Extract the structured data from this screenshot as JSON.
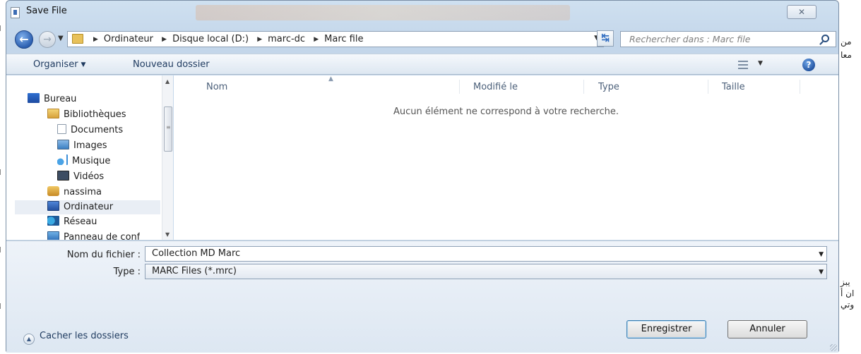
{
  "window": {
    "title": "Save File",
    "close_glyph": "✕"
  },
  "address": {
    "crumbs": [
      "Ordinateur",
      "Disque local (D:)",
      "marc-dc",
      "Marc file"
    ],
    "search_placeholder": "Rechercher dans : Marc file"
  },
  "toolbar": {
    "organize_label": "Organiser",
    "new_folder_label": "Nouveau dossier",
    "help_glyph": "?"
  },
  "nav": {
    "items": [
      {
        "label": "Bureau",
        "icon": "desktop-icon"
      },
      {
        "label": "Bibliothèques",
        "icon": "libraries-icon"
      },
      {
        "label": "Documents",
        "icon": "documents-icon"
      },
      {
        "label": "Images",
        "icon": "images-icon"
      },
      {
        "label": "Musique",
        "icon": "music-icon"
      },
      {
        "label": "Vidéos",
        "icon": "videos-icon"
      },
      {
        "label": "nassima",
        "icon": "user-folder-icon"
      },
      {
        "label": "Ordinateur",
        "icon": "computer-icon"
      },
      {
        "label": "Réseau",
        "icon": "network-icon"
      },
      {
        "label": "Panneau de conf",
        "icon": "control-panel-icon"
      }
    ]
  },
  "files": {
    "columns": [
      "Nom",
      "Modifié le",
      "Type",
      "Taille"
    ],
    "empty_message": "Aucun élément ne correspond à votre recherche."
  },
  "form": {
    "filename_label": "Nom du fichier :",
    "filename_value": "Collection MD Marc",
    "type_label": "Type :",
    "type_value": "MARC Files (*.mrc)",
    "hide_folders_label": "Cacher les dossiers",
    "save_label": "Enregistrer",
    "cancel_label": "Annuler"
  },
  "background": {
    "right_fragments": [
      "من",
      "معا",
      "يبز",
      "ان أ",
      "وتي"
    ]
  },
  "colors": {
    "accent": "#2c5fb0",
    "window_frame": "#c3d6ea",
    "toolbar": "#dde7f1"
  }
}
